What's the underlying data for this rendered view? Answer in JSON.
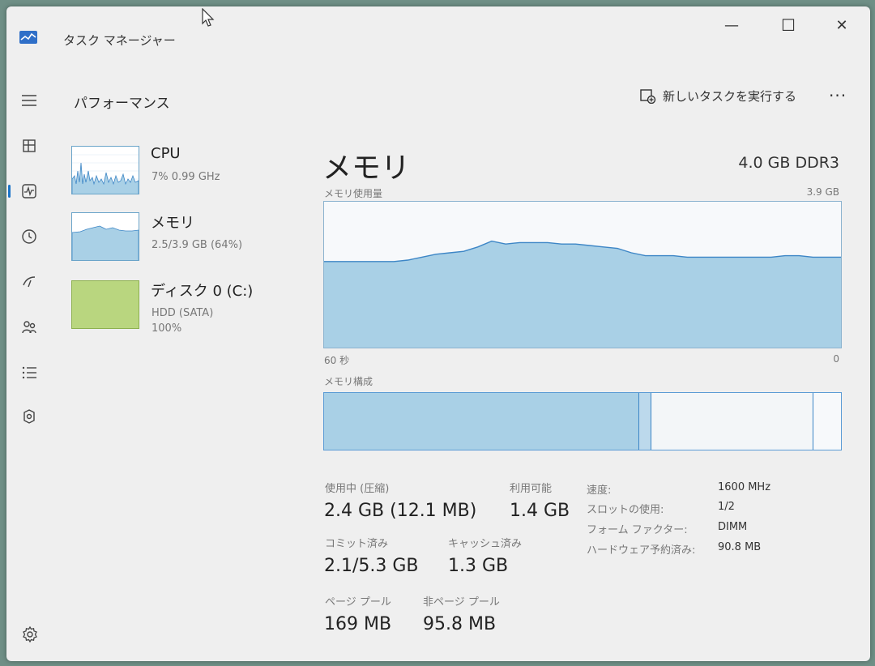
{
  "app": {
    "title": "タスク マネージャー"
  },
  "window_controls": {
    "minimize": "—",
    "maximize": "☐",
    "close": "✕"
  },
  "header": {
    "page_title": "パフォーマンス",
    "run_task_label": "新しいタスクを実行する",
    "more": "···"
  },
  "devices": [
    {
      "name": "CPU",
      "line1": "7%  0.99 GHz",
      "line2": ""
    },
    {
      "name": "メモリ",
      "line1": "2.5/3.9 GB (64%)",
      "line2": ""
    },
    {
      "name": "ディスク 0 (C:)",
      "line1": "HDD (SATA)",
      "line2": "100%"
    }
  ],
  "detail": {
    "title": "メモリ",
    "spec": "4.0 GB DDR3",
    "usage_label": "メモリ使用量",
    "usage_max": "3.9 GB",
    "axis_left": "60 秒",
    "axis_right": "0",
    "composition_label": "メモリ構成",
    "usage_series": [
      0.59,
      0.59,
      0.59,
      0.59,
      0.59,
      0.59,
      0.6,
      0.62,
      0.64,
      0.65,
      0.66,
      0.69,
      0.73,
      0.71,
      0.72,
      0.72,
      0.72,
      0.71,
      0.71,
      0.7,
      0.69,
      0.68,
      0.65,
      0.63,
      0.63,
      0.63,
      0.62,
      0.62,
      0.62,
      0.62,
      0.62,
      0.62,
      0.62,
      0.63,
      0.63,
      0.62,
      0.62,
      0.62
    ],
    "composition": {
      "in_use": 0.608,
      "modified": 0.025,
      "standby": 0.312,
      "free": 0.055
    }
  },
  "stats": {
    "in_use_label": "使用中 (圧縮)",
    "in_use_value": "2.4 GB (12.1 MB)",
    "available_label": "利用可能",
    "available_value": "1.4 GB",
    "committed_label": "コミット済み",
    "committed_value": "2.1/5.3 GB",
    "cached_label": "キャッシュ済み",
    "cached_value": "1.3 GB",
    "paged_label": "ページ プール",
    "paged_value": "169 MB",
    "nonpaged_label": "非ページ プール",
    "nonpaged_value": "95.8 MB"
  },
  "specs": {
    "speed_label": "速度:",
    "speed_value": "1600 MHz",
    "slots_label": "スロットの使用:",
    "slots_value": "1/2",
    "form_label": "フォーム ファクター:",
    "form_value": "DIMM",
    "reserved_label": "ハードウェア予約済み:",
    "reserved_value": "90.8 MB"
  },
  "colors": {
    "accent": "#1a73c8",
    "memory_fill": "#a9d0e6",
    "memory_line": "#3d86c6",
    "disk_fill": "#b9d67f"
  },
  "icons": {
    "nav": [
      "hamburger-icon",
      "processes-icon",
      "performance-icon",
      "app-history-icon",
      "startup-icon",
      "users-icon",
      "details-icon",
      "services-icon"
    ],
    "settings": "settings-icon"
  }
}
